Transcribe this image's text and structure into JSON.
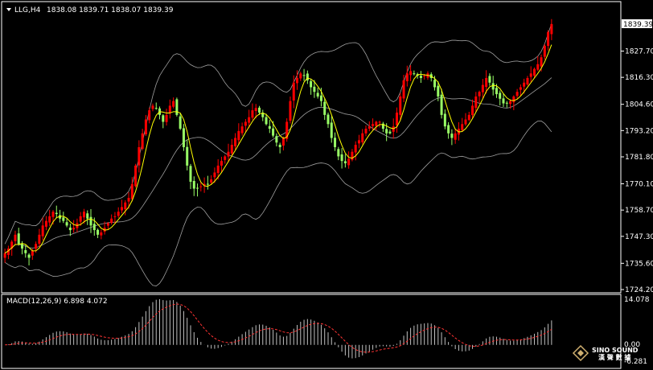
{
  "header": {
    "symbol": "LLG,H4",
    "ohlc": "1838.08 1839.71 1838.07 1839.39"
  },
  "price_axis": {
    "current_price": "1839.39",
    "ticks": [
      "1827.70",
      "1816.30",
      "1804.60",
      "1793.20",
      "1781.80",
      "1770.10",
      "1758.70",
      "1747.30",
      "1735.60",
      "1724.20"
    ]
  },
  "macd": {
    "label": "MACD(12,26,9) 6.898 4.072",
    "ticks": [
      "14.078",
      "0.00",
      "-6.281"
    ]
  },
  "logo": {
    "name": "SINO SOUND",
    "sub": "漢 聲 數 據"
  },
  "colors": {
    "background": "#000000",
    "up_candle": "#ff0000",
    "down_candle": "#99ff66",
    "ma": "#ffff00",
    "bands": "#a0a0a0",
    "macd_hist": "#c0c0c0",
    "macd_signal": "#ff3333"
  },
  "chart_data": {
    "type": "candlestick",
    "timeframe": "H4",
    "ylim": [
      1724.2,
      1839.39
    ],
    "macd_ylim": [
      -6.281,
      14.078
    ],
    "indicators": [
      "Bollinger Bands",
      "Moving Average",
      "MACD(12,26,9)"
    ],
    "closes": [
      1740,
      1742,
      1745,
      1748,
      1744,
      1742,
      1740,
      1738,
      1741,
      1744,
      1748,
      1752,
      1754,
      1756,
      1758,
      1757,
      1755,
      1754,
      1752,
      1750,
      1751,
      1753,
      1756,
      1758,
      1755,
      1752,
      1750,
      1748,
      1749,
      1751,
      1753,
      1755,
      1756,
      1758,
      1760,
      1762,
      1764,
      1770,
      1778,
      1786,
      1792,
      1798,
      1802,
      1804,
      1803,
      1800,
      1797,
      1800,
      1804,
      1806,
      1800,
      1794,
      1786,
      1778,
      1771,
      1768,
      1768,
      1769,
      1770,
      1770,
      1772,
      1775,
      1778,
      1780,
      1782,
      1784,
      1787,
      1790,
      1793,
      1795,
      1797,
      1799,
      1802,
      1803,
      1801,
      1799,
      1796,
      1794,
      1791,
      1788,
      1786,
      1790,
      1797,
      1806,
      1814,
      1816,
      1818,
      1817,
      1815,
      1812,
      1810,
      1808,
      1806,
      1800,
      1796,
      1790,
      1786,
      1782,
      1780,
      1779,
      1781,
      1784,
      1787,
      1789,
      1792,
      1794,
      1795,
      1796,
      1797,
      1797,
      1794,
      1792,
      1792,
      1795,
      1801,
      1808,
      1815,
      1818,
      1819,
      1818,
      1817,
      1816,
      1817,
      1818,
      1816,
      1812,
      1808,
      1800,
      1795,
      1792,
      1790,
      1792,
      1794,
      1796,
      1798,
      1800,
      1804,
      1808,
      1810,
      1813,
      1816,
      1814,
      1811,
      1809,
      1807,
      1805,
      1805,
      1806,
      1808,
      1810,
      1812,
      1814,
      1816,
      1818,
      1820,
      1822,
      1825,
      1830,
      1836,
      1839.39
    ]
  }
}
